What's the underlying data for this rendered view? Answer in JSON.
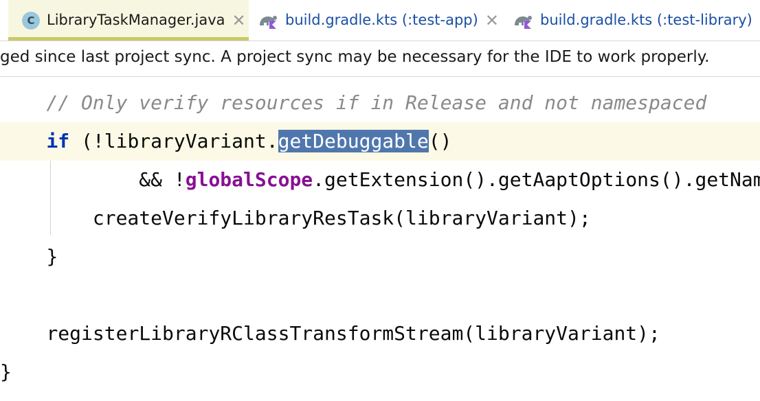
{
  "tabs": [
    {
      "label": "LibraryTaskManager.java",
      "icon": "java-class-icon",
      "icon_letter": "C",
      "active": true
    },
    {
      "label": "build.gradle.kts (:test-app)",
      "icon": "gradle-kotlin-icon",
      "active": false
    },
    {
      "label": "build.gradle.kts (:test-library)",
      "icon": "gradle-kotlin-icon",
      "active": false
    }
  ],
  "close_glyph": "✕",
  "banner": {
    "text": "ged since last project sync. A project sync may be necessary for the IDE to work properly."
  },
  "code": {
    "line1_comment": "// Only verify resources if in Release and not namespaced",
    "line2_keyword": "if",
    "line2_pre": " (!libraryVariant.",
    "line2_selected": "getDebuggable",
    "line2_post": "()",
    "line3_pre": "&& !",
    "line3_field": "globalScope",
    "line3_post": ".getExtension().getAaptOptions().getNamespaced()",
    "line4": "createVerifyLibraryResTask(libraryVariant);",
    "line5": "}",
    "line7": "registerLibraryRClassTransformStream(libraryVariant);",
    "line8": "}"
  },
  "colors": {
    "keyword": "#0033b3",
    "comment": "#8a8a8a",
    "field": "#871094",
    "selection": "#5077ad",
    "caret_line": "#fcfae6",
    "active_tab": "#f7f7e1",
    "link_tab_text": "#1a4fa5"
  }
}
